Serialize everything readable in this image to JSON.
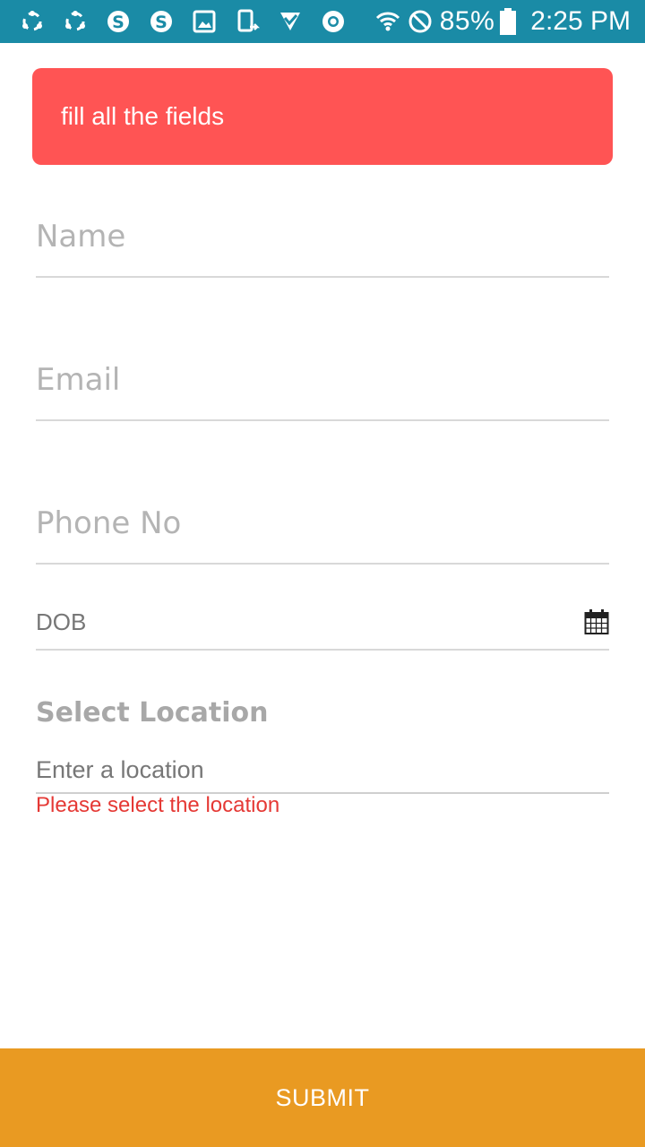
{
  "status_bar": {
    "icons": [
      "share-icon",
      "share-icon",
      "skype-icon",
      "skype-icon",
      "image-icon",
      "screenshot-icon",
      "download-icon",
      "chrome-icon"
    ],
    "wifi_icon": "wifi-icon",
    "block_icon": "do-not-disturb-icon",
    "battery": "85%",
    "time": "2:25 PM",
    "colors": {
      "background": "#1a8ba6"
    }
  },
  "alert": {
    "message": "fill all the fields",
    "color": "#ff5454"
  },
  "form": {
    "name_placeholder": "Name",
    "email_placeholder": "Email",
    "phone_placeholder": "Phone No",
    "dob_label": "DOB",
    "calendar_icon": "calendar-icon",
    "location_section_title": "Select Location",
    "location_placeholder": "Enter a location",
    "location_error": "Please select the location"
  },
  "submit": {
    "label": "SUBMIT",
    "color": "#e99a22"
  }
}
